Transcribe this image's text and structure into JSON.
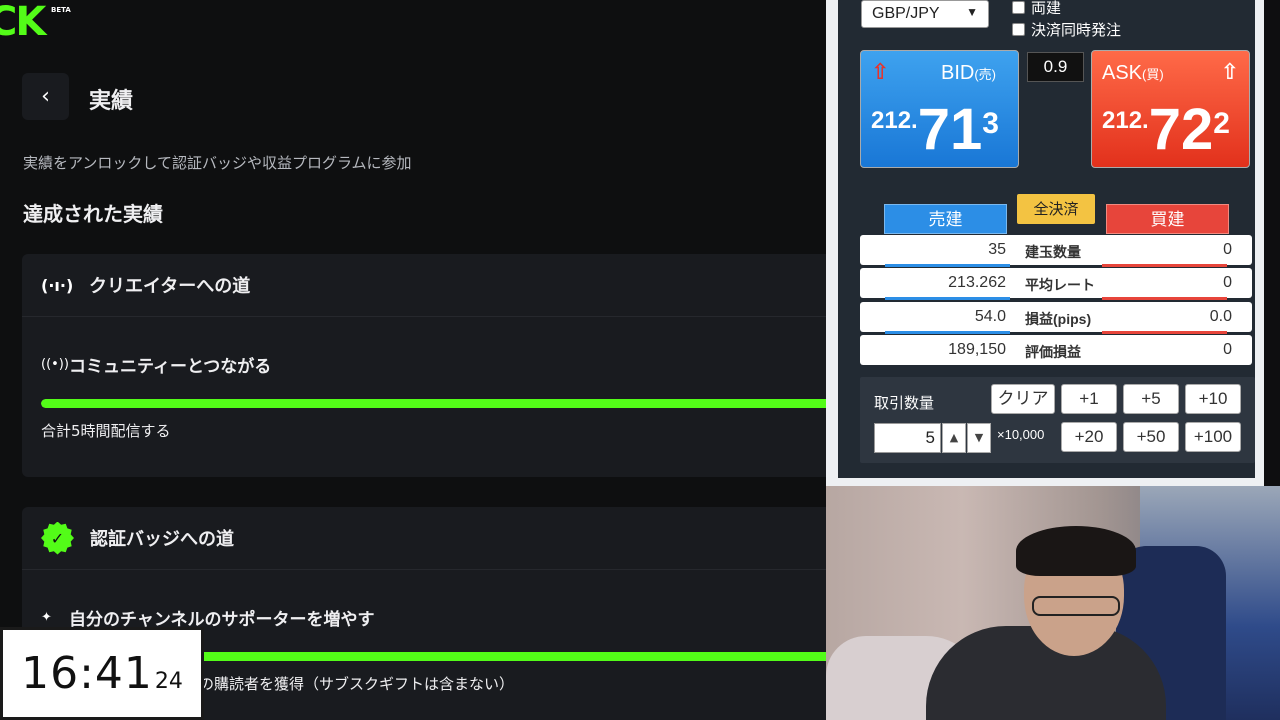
{
  "kick": {
    "logo": "CK",
    "beta": "BETA",
    "back_icon": "chevron-left-icon",
    "title": "実績",
    "subtitle": "実績をアンロックして認証バッジや収益プログラムに参加",
    "section_title": "達成された実績",
    "cards": [
      {
        "icon": "broadcast-icon",
        "title": "クリエイターへの道",
        "item_icon": "broadcast-icon",
        "item_title": "コミュニティーとつながる",
        "progress": 1.0,
        "item_desc": "合計5時間配信する"
      },
      {
        "icon": "verified-badge-icon",
        "title": "認証バッジへの道",
        "item_icon": "sparkle-icon",
        "item_title": "自分のチャンネルのサポーターを増やす",
        "progress": 1.0,
        "item_desc": "の購読者を獲得（サブスクギフトは含まない）"
      }
    ]
  },
  "clock": {
    "hm": "16:41",
    "sec": "24"
  },
  "trade": {
    "pair": "GBP/JPY",
    "options": [
      "両建",
      "決済同時発注"
    ],
    "bid": {
      "label": "BID",
      "sub": "(売)",
      "p1": "212.",
      "p2": "71",
      "p3": "3"
    },
    "ask": {
      "label": "ASK",
      "sub": "(買)",
      "p1": "212.",
      "p2": "72",
      "p3": "2"
    },
    "spread": "0.9",
    "sell_label": "売建",
    "buy_label": "買建",
    "close_all_label": "全決済",
    "rows": [
      {
        "left": "35",
        "center": "建玉数量",
        "right": "0"
      },
      {
        "left": "213.262",
        "center": "平均レート",
        "right": "0"
      },
      {
        "left": "54.0",
        "center": "損益(pips)",
        "right": "0.0"
      },
      {
        "left": "189,150",
        "center": "評価損益",
        "right": "0"
      }
    ],
    "qty_label": "取引数量",
    "clear_label": "クリア",
    "quick_buttons": [
      "+1",
      "+5",
      "+10",
      "+20",
      "+50",
      "+100"
    ],
    "qty_value": "5",
    "unit": "×10,000",
    "up_icon": "▲",
    "down_icon": "▼",
    "bid_color": "#1977d6",
    "ask_color": "#e2311c"
  }
}
